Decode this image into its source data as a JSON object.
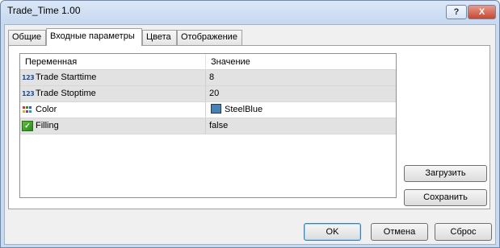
{
  "window": {
    "title": "Trade_Time 1.00",
    "help_label": "?",
    "close_label": "X"
  },
  "tabs": [
    {
      "label": "Общие"
    },
    {
      "label": "Входные параметры",
      "active": true
    },
    {
      "label": "Цвета"
    },
    {
      "label": "Отображение"
    }
  ],
  "grid": {
    "headers": {
      "variable": "Переменная",
      "value": "Значение"
    },
    "rows": [
      {
        "icon": "integer-123-icon",
        "name": "Trade Starttime",
        "value": "8"
      },
      {
        "icon": "integer-123-icon",
        "name": "Trade Stoptime",
        "value": "20"
      },
      {
        "icon": "color-palette-icon",
        "name": "Color",
        "value": "SteelBlue",
        "swatch": "#4682b4"
      },
      {
        "icon": "boolean-fill-icon",
        "name": "Filling",
        "value": "false"
      }
    ]
  },
  "side_buttons": {
    "load": "Загрузить",
    "save": "Сохранить"
  },
  "footer_buttons": {
    "ok": "OK",
    "cancel": "Отмена",
    "reset": "Сброс"
  }
}
